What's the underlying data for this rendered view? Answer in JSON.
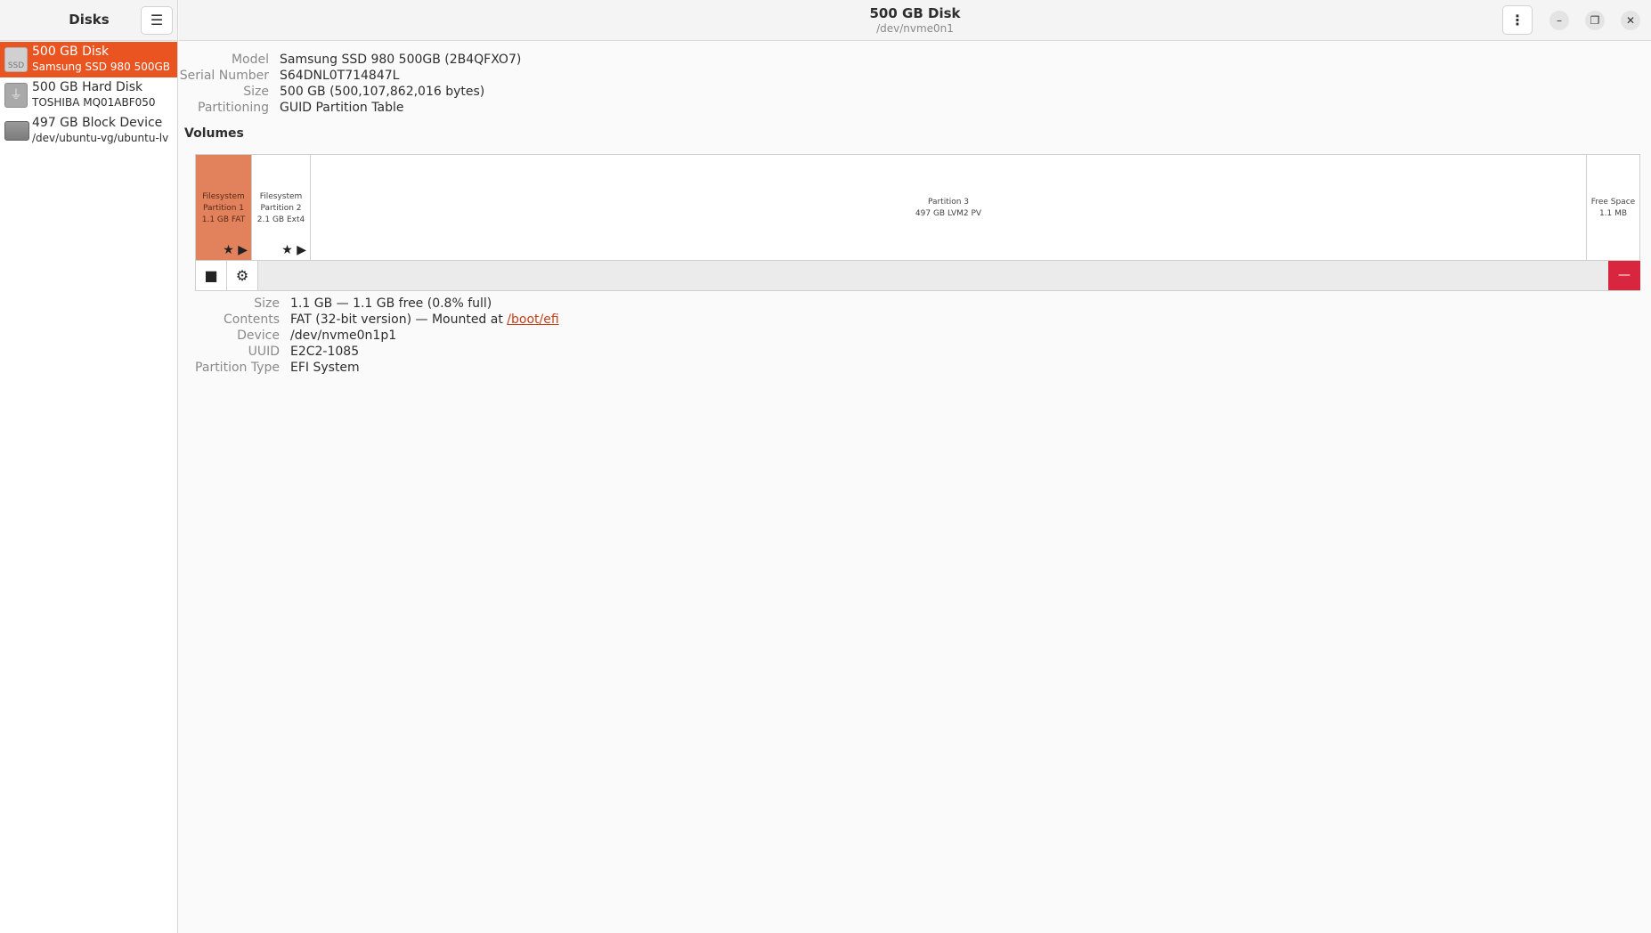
{
  "sidebar": {
    "title": "Disks",
    "drives": [
      {
        "name": "500 GB Disk",
        "sub": "Samsung SSD 980 500GB",
        "icon": "SSD",
        "selected": true
      },
      {
        "name": "500 GB Hard Disk",
        "sub": "TOSHIBA MQ01ABF050",
        "icon": "usb"
      },
      {
        "name": "497 GB Block Device",
        "sub": "/dev/ubuntu-vg/ubuntu-lv",
        "icon": "block"
      }
    ]
  },
  "header": {
    "title": "500 GB Disk",
    "subtitle": "/dev/nvme0n1",
    "kebab": "⋮",
    "minimize": "–",
    "restore": "❐",
    "close": "✕"
  },
  "disk_info": [
    {
      "label": "Model",
      "value": "Samsung SSD 980 500GB (2B4QFXO7)"
    },
    {
      "label": "Serial Number",
      "value": "S64DNL0T714847L"
    },
    {
      "label": "Size",
      "value": "500 GB (500,107,862,016 bytes)"
    },
    {
      "label": "Partitioning",
      "value": "GUID Partition Table"
    }
  ],
  "volumes": {
    "title": "Volumes",
    "partitions": [
      {
        "lines": [
          "Filesystem",
          "Partition 1",
          "1.1 GB FAT"
        ],
        "icons": "★ ▶",
        "selected": true
      },
      {
        "lines": [
          "Filesystem",
          "Partition 2",
          "2.1 GB Ext4"
        ],
        "icons": "★ ▶"
      },
      {
        "lines": [
          "Partition 3",
          "497 GB LVM2 PV"
        ]
      },
      {
        "lines": [
          "Free Space",
          "1.1 MB"
        ]
      }
    ],
    "toolbar": {
      "stop": "■",
      "settings": "⚙",
      "delete": "—"
    }
  },
  "partition_info": [
    {
      "label": "Size",
      "value": "1.1 GB — 1.1 GB free (0.8% full)"
    },
    {
      "label": "Contents",
      "value": "FAT (32-bit version) — Mounted at ",
      "link": "/boot/efi"
    },
    {
      "label": "Device",
      "value": "/dev/nvme0n1p1"
    },
    {
      "label": "UUID",
      "value": "E2C2-1085"
    },
    {
      "label": "Partition Type",
      "value": "EFI System"
    }
  ],
  "colors": {
    "accent": "#e95420",
    "selected_partition": "#e1825d",
    "delete": "#d7263d"
  }
}
